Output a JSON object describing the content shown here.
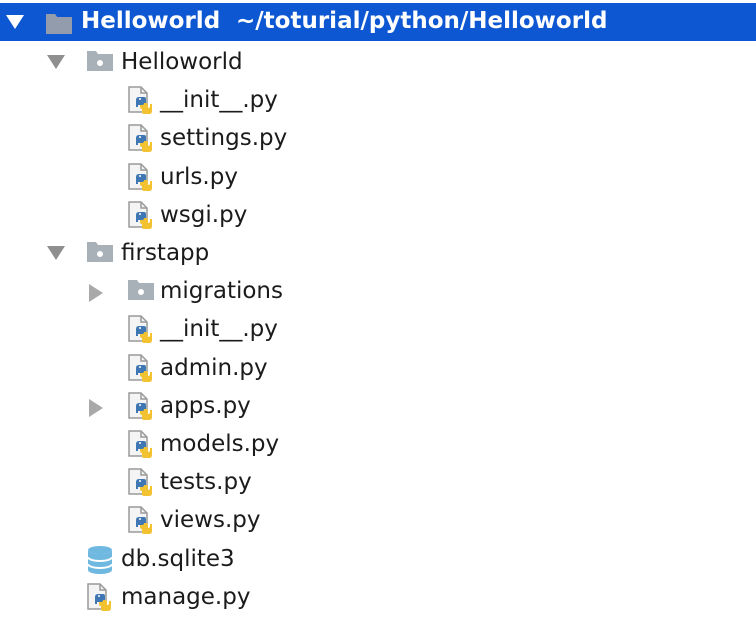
{
  "project": {
    "name": "Helloworld",
    "path": "~/toturial/python/Helloworld"
  },
  "tree": [
    {
      "label": "Helloworld",
      "icon": "folder-icon",
      "toggle": "expanded"
    },
    {
      "label": "__init__.py",
      "icon": "python-file-icon",
      "toggle": "none"
    },
    {
      "label": "settings.py",
      "icon": "python-file-icon",
      "toggle": "none"
    },
    {
      "label": "urls.py",
      "icon": "python-file-icon",
      "toggle": "none"
    },
    {
      "label": "wsgi.py",
      "icon": "python-file-icon",
      "toggle": "none"
    },
    {
      "label": "firstapp",
      "icon": "folder-icon",
      "toggle": "expanded"
    },
    {
      "label": "migrations",
      "icon": "folder-icon",
      "toggle": "collapsed"
    },
    {
      "label": "__init__.py",
      "icon": "python-file-icon",
      "toggle": "none"
    },
    {
      "label": "admin.py",
      "icon": "python-file-icon",
      "toggle": "none"
    },
    {
      "label": "apps.py",
      "icon": "python-file-icon",
      "toggle": "collapsed"
    },
    {
      "label": "models.py",
      "icon": "python-file-icon",
      "toggle": "none"
    },
    {
      "label": "tests.py",
      "icon": "python-file-icon",
      "toggle": "none"
    },
    {
      "label": "views.py",
      "icon": "python-file-icon",
      "toggle": "none"
    },
    {
      "label": "db.sqlite3",
      "icon": "database-icon",
      "toggle": "none"
    },
    {
      "label": "manage.py",
      "icon": "python-file-icon",
      "toggle": "none"
    }
  ],
  "colors": {
    "selection": "#0d58d2",
    "folder": "#a8b0b8",
    "python_blue": "#3e77b3",
    "python_yellow": "#f2c230",
    "database": "#6fb8e0"
  }
}
